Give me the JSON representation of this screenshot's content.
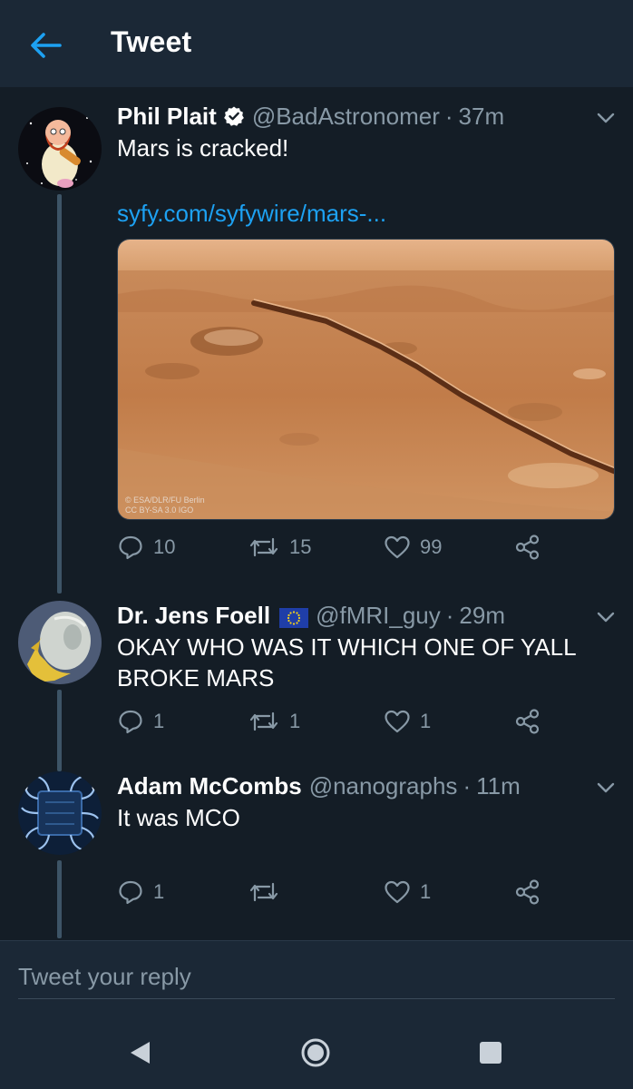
{
  "header": {
    "title": "Tweet",
    "back_icon": "arrow-left-icon"
  },
  "colors": {
    "accent": "#1da1f2",
    "background": "#141d26",
    "bar": "#1b2836",
    "muted": "#8899a6"
  },
  "tweets": [
    {
      "name": "Phil Plait",
      "verified": true,
      "handle": "@BadAstronomer",
      "sep": "·",
      "time": "37m",
      "text": "Mars is cracked!",
      "link": "syfy.com/syfywire/mars-...",
      "media_credit": "© ESA/DLR/FU Berlin\nCC BY-SA 3.0 IGO",
      "replies": "10",
      "retweets": "15",
      "likes": "99"
    },
    {
      "name": "Dr. Jens Foell",
      "flag_icon": "eu-flag-icon",
      "handle": "@fMRI_guy",
      "sep": "·",
      "time": "29m",
      "text": "OKAY WHO WAS IT WHICH ONE OF YALL\nBROKE MARS",
      "replies": "1",
      "retweets": "1",
      "likes": "1"
    },
    {
      "name": "Adam McCombs",
      "handle": "@nanographs",
      "sep": "·",
      "time": "11m",
      "text": "It was MCO",
      "replies": "1",
      "retweets": "",
      "likes": "1"
    }
  ],
  "reply_bar": {
    "placeholder": "Tweet your reply"
  },
  "nav": {
    "back": "nav-back-icon",
    "home": "nav-home-icon",
    "recents": "nav-recents-icon"
  }
}
